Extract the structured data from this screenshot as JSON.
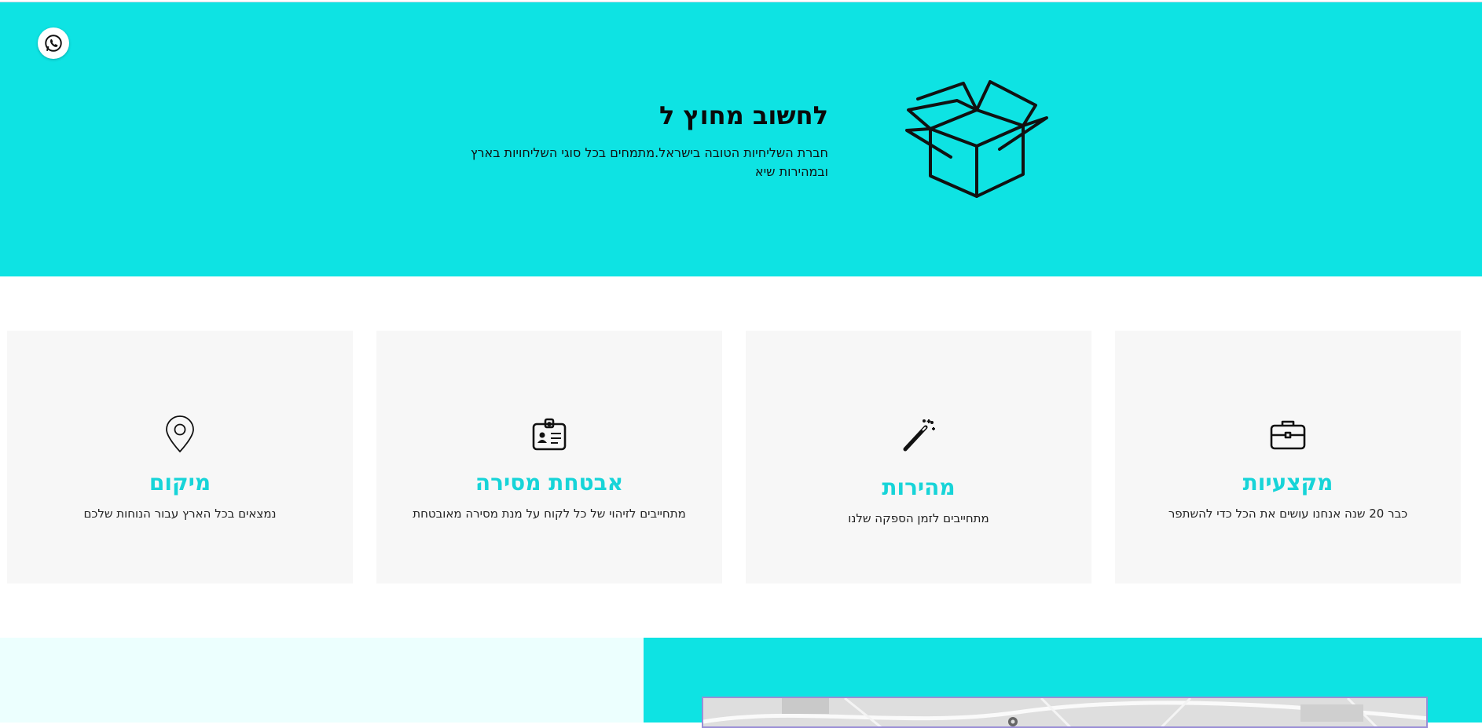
{
  "hero": {
    "title": "לחשוב מחוץ ל",
    "description": "חברת השליחיות הטובה בישראל.מתמחים בכל סוגי השליחויות בארץ ובמהירות שיא",
    "background_color": "#0ee3e3",
    "illustration_icon": "open-box-icon"
  },
  "floating": {
    "whatsapp_icon": "whatsapp-icon"
  },
  "features": [
    {
      "icon": "briefcase-icon",
      "title": "מקצעיות",
      "description": "כבר 20 שנה אנחנו עושים את הכל כדי להשתפר"
    },
    {
      "icon": "magic-wand-icon",
      "title": "מהירות",
      "description": "מתחייבים לזמן הספקה שלנו"
    },
    {
      "icon": "id-badge-icon",
      "title": "אבטחת מסירה",
      "description": "מתחייבים לזיהוי של כל לקוח על מנת מסירה מאובטחת"
    },
    {
      "icon": "location-pin-icon",
      "title": "מיקום",
      "description": "נמצאים בכל הארץ עבור הנוחות שלכם"
    }
  ],
  "colors": {
    "accent": "#17d4d8",
    "card_background": "#f7f7f7",
    "light_panel": "#ecfffe"
  }
}
